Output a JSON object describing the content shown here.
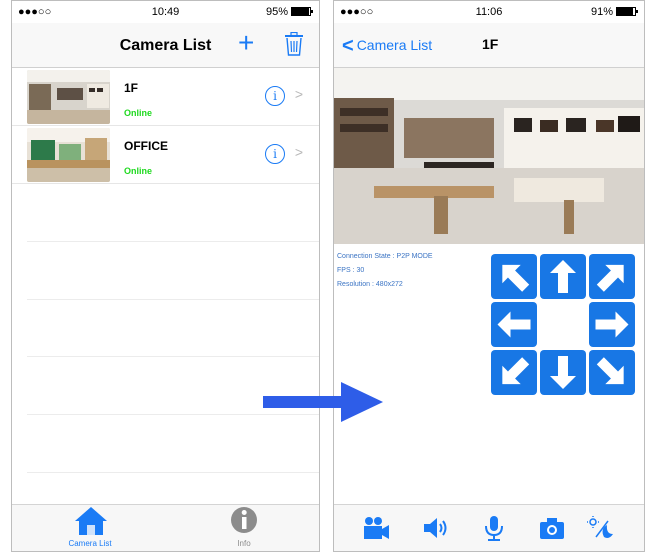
{
  "left": {
    "status": {
      "signal": "●●●○○ ",
      "time": "10:49",
      "battery": "95%",
      "battery_level": 0.95
    },
    "title": "Camera List",
    "add_label": "+",
    "cameras": [
      {
        "name": "1F",
        "status": "Online"
      },
      {
        "name": "OFFICE",
        "status": "Online"
      }
    ],
    "tabs": [
      {
        "label": "Camera List",
        "icon": "home-icon",
        "active": true
      },
      {
        "label": "Info",
        "icon": "info-icon",
        "active": false
      }
    ]
  },
  "right": {
    "status": {
      "signal": "●●●○○ ",
      "time": "11:06",
      "battery": "91%",
      "battery_level": 0.91
    },
    "back_label": "Camera List",
    "title": "1F",
    "stats": [
      "Connection State : P2P MODE",
      "FPS : 30",
      "Resolution : 480x272"
    ],
    "ptz_controls": [
      "up-left",
      "up",
      "up-right",
      "left",
      "right",
      "down-left",
      "down",
      "down-right"
    ],
    "toolbar": [
      "video-camera-icon",
      "speaker-icon",
      "microphone-icon",
      "camera-icon",
      "night-mode-icon"
    ]
  },
  "colors": {
    "accent": "#1a7bf5",
    "online": "#1fd91f",
    "ptz": "#1877e5",
    "arrow": "#2e5de8"
  }
}
